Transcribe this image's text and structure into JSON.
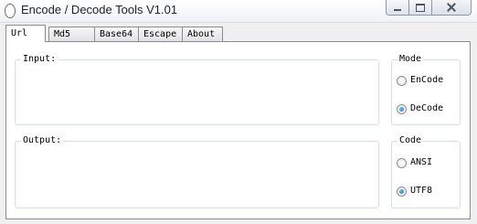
{
  "window": {
    "title": "Encode / Decode Tools V1.01"
  },
  "tabs": [
    {
      "label": "Url",
      "active": true
    },
    {
      "label": "Md5",
      "active": false
    },
    {
      "label": "Base64",
      "active": false
    },
    {
      "label": "Escape",
      "active": false
    },
    {
      "label": "About",
      "active": false
    }
  ],
  "input_group": {
    "title": "Input:"
  },
  "output_group": {
    "title": "Output:"
  },
  "mode_group": {
    "title": "Mode",
    "options": [
      {
        "label": "EnCode",
        "checked": false
      },
      {
        "label": "DeCode",
        "checked": true
      }
    ]
  },
  "code_group": {
    "title": "Code",
    "options": [
      {
        "label": "ANSI",
        "checked": false
      },
      {
        "label": "UTF8",
        "checked": true
      }
    ]
  },
  "icons": {
    "app": "app-icon",
    "minimize": "minimize-icon",
    "maximize": "maximize-icon",
    "close": "close-icon"
  }
}
